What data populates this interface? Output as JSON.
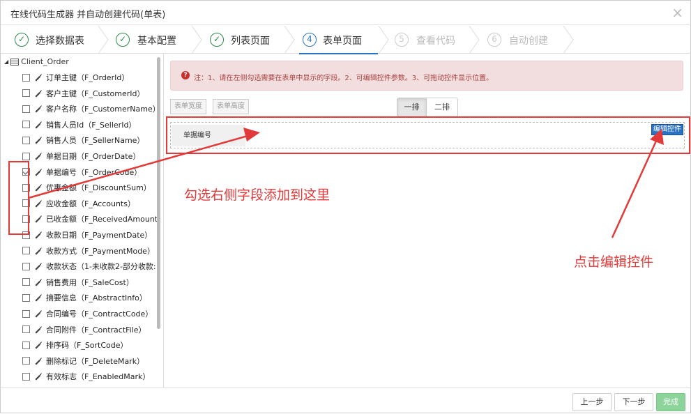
{
  "window": {
    "title": "在线代码生成器 并自动创建代码(单表)",
    "close_label": "×"
  },
  "steps": [
    {
      "label": "选择数据表",
      "state": "done",
      "icon": "✓"
    },
    {
      "label": "基本配置",
      "state": "done",
      "icon": "✓"
    },
    {
      "label": "列表页面",
      "state": "done",
      "icon": "✓"
    },
    {
      "label": "表单页面",
      "state": "active",
      "icon": "4"
    },
    {
      "label": "查看代码",
      "state": "pending",
      "icon": "5"
    },
    {
      "label": "自动创建",
      "state": "pending",
      "icon": "6"
    }
  ],
  "tree": {
    "root": "Client_Order",
    "items": [
      {
        "label": "订单主键（F_OrderId）",
        "checked": false
      },
      {
        "label": "客户主键（F_CustomerId）",
        "checked": false
      },
      {
        "label": "客户名称（F_CustomerName）",
        "checked": false
      },
      {
        "label": "销售人员Id（F_SellerId）",
        "checked": false
      },
      {
        "label": "销售人员（F_SellerName）",
        "checked": false
      },
      {
        "label": "单据日期（F_OrderDate）",
        "checked": false
      },
      {
        "label": "单据编号（F_OrderCode）",
        "checked": true
      },
      {
        "label": "优惠金额（F_DiscountSum）",
        "checked": false
      },
      {
        "label": "应收金额（F_Accounts）",
        "checked": false
      },
      {
        "label": "已收金额（F_ReceivedAmount",
        "checked": false
      },
      {
        "label": "收款日期（F_PaymentDate）",
        "checked": false
      },
      {
        "label": "收款方式（F_PaymentMode）",
        "checked": false
      },
      {
        "label": "收款状态（1-未收款2-部分收款:",
        "checked": false
      },
      {
        "label": "销售费用（F_SaleCost）",
        "checked": false
      },
      {
        "label": "摘要信息（F_AbstractInfo）",
        "checked": false
      },
      {
        "label": "合同编号（F_ContractCode）",
        "checked": false
      },
      {
        "label": "合同附件（F_ContractFile）",
        "checked": false
      },
      {
        "label": "排序码（F_SortCode）",
        "checked": false
      },
      {
        "label": "删除标记（F_DeleteMark）",
        "checked": false
      },
      {
        "label": "有效标志（F_EnabledMark）",
        "checked": false
      }
    ]
  },
  "alert": {
    "text": "注：1、请在左侧勾选需要在表单中显示的字段。2、可编辑控件参数。3、可拖动控件显示位置。"
  },
  "toolbar": {
    "form_width": "表单宽度",
    "form_height": "表单高度",
    "layout_one": "一排",
    "layout_two": "二排"
  },
  "form": {
    "field_label": "单据编号",
    "edit_control": "编辑控件"
  },
  "annotations": {
    "left": "勾选右侧字段添加到这里",
    "right": "点击编辑控件",
    "color": "#e23a3a"
  },
  "footer": {
    "prev": "上一步",
    "next": "下一步",
    "finish": "完成"
  }
}
